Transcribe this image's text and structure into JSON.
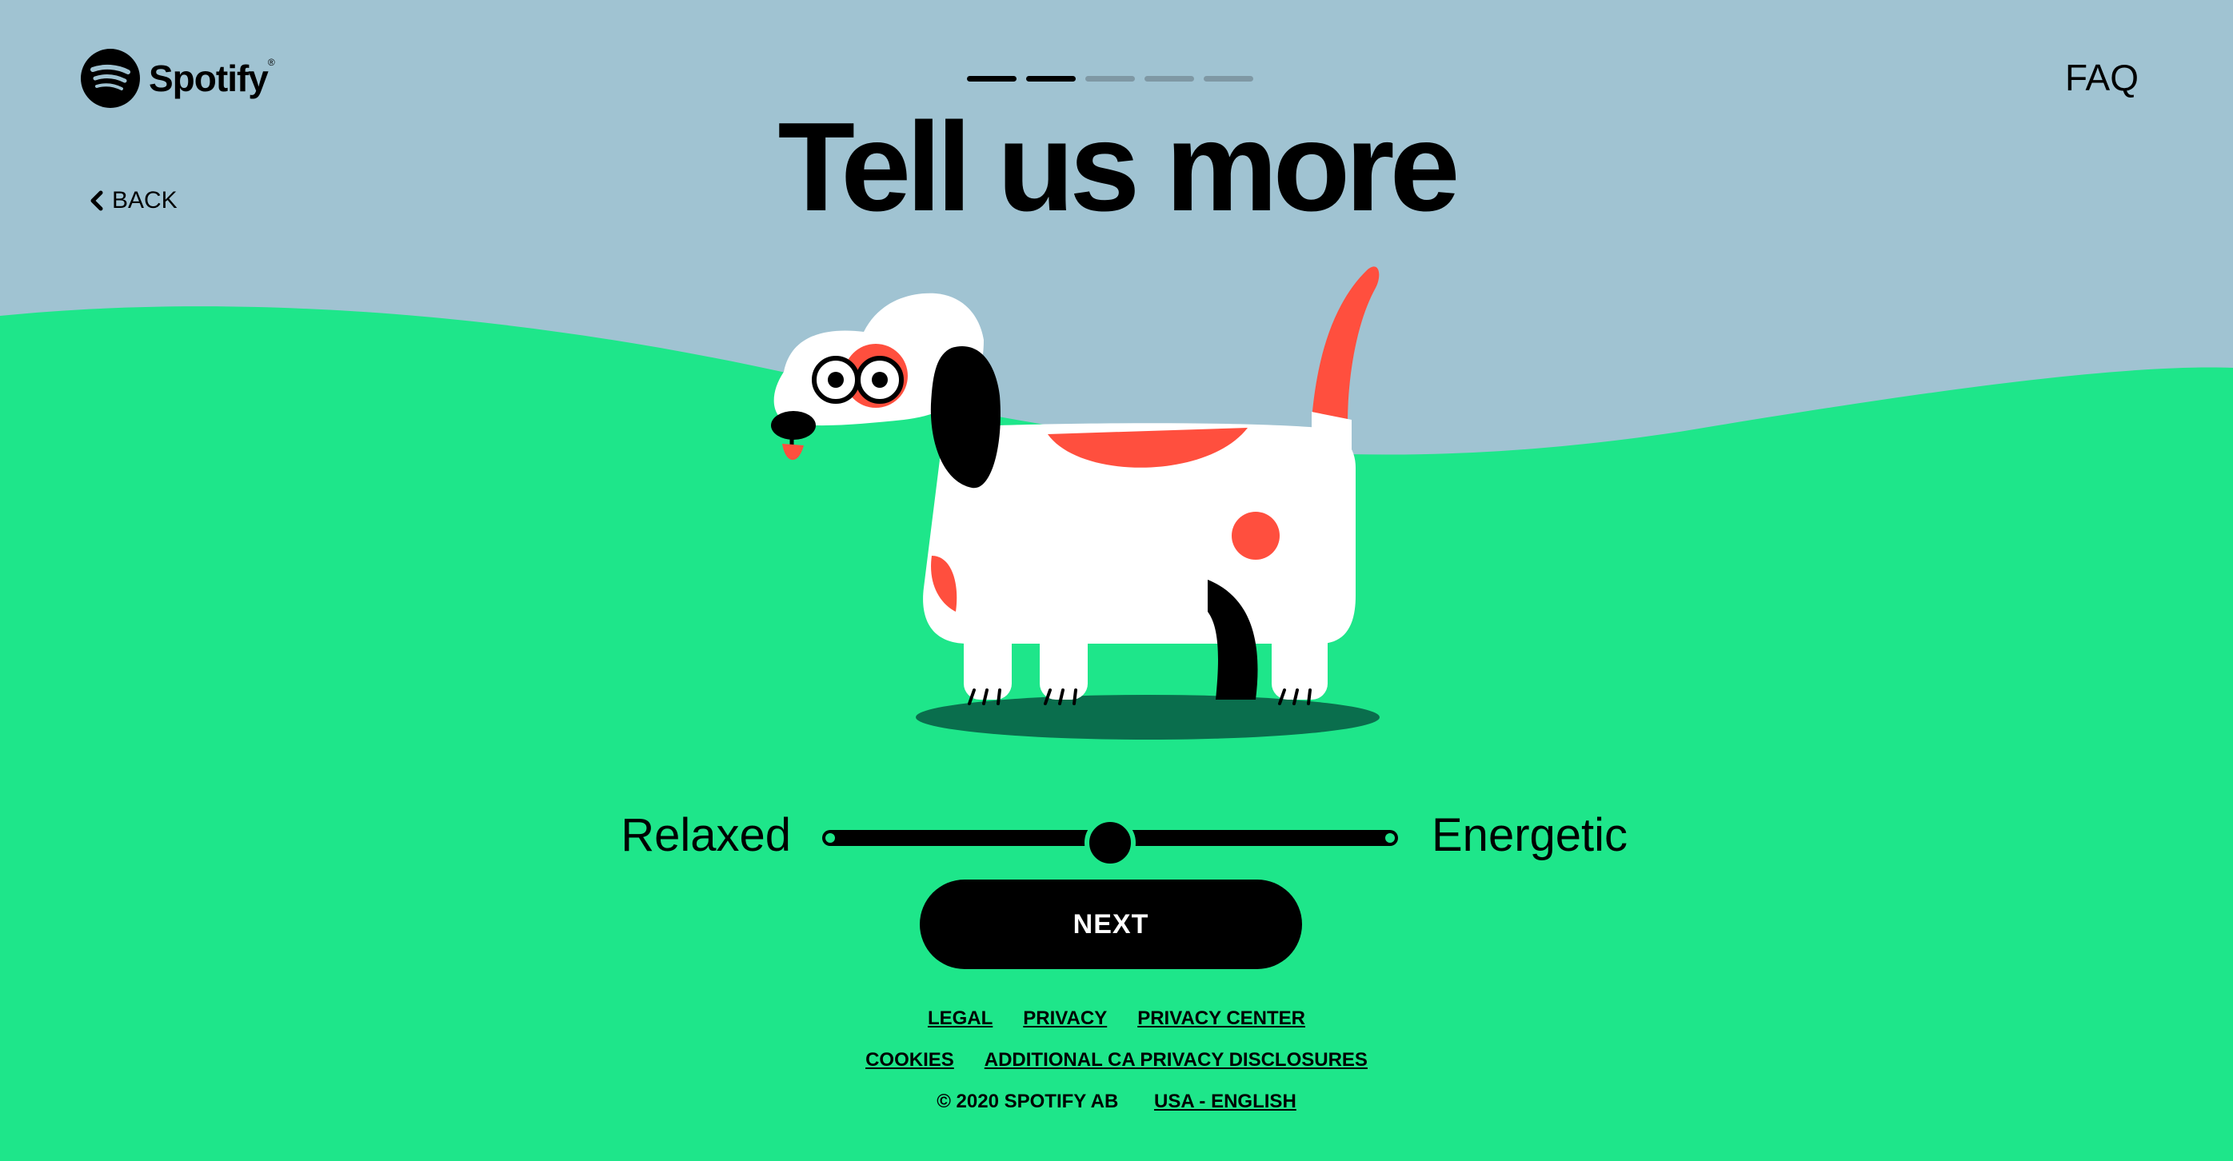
{
  "brand": {
    "name": "Spotify",
    "registered": "®"
  },
  "nav": {
    "back_label": "BACK",
    "faq_label": "FAQ"
  },
  "progress": {
    "total_steps": 5,
    "current_step": 2
  },
  "page": {
    "title": "Tell us more"
  },
  "slider": {
    "left_label": "Relaxed",
    "right_label": "Energetic",
    "value": 0.5
  },
  "actions": {
    "next_label": "NEXT"
  },
  "footer": {
    "links_row1": [
      "LEGAL",
      "PRIVACY",
      "PRIVACY CENTER"
    ],
    "links_row2": [
      "COOKIES",
      "ADDITIONAL CA PRIVACY DISCLOSURES"
    ],
    "copyright": "© 2020 SPOTIFY AB",
    "locale": "USA - ENGLISH"
  },
  "colors": {
    "sky": "#a0c3d2",
    "grass": "#1ee68a",
    "shadow": "#0a6e4d",
    "dog_spot": "#ff4f3e",
    "dog_body": "#ffffff",
    "text": "#000000"
  },
  "icons": {
    "logo": "spotify-logo-icon",
    "back": "chevron-left-icon"
  }
}
